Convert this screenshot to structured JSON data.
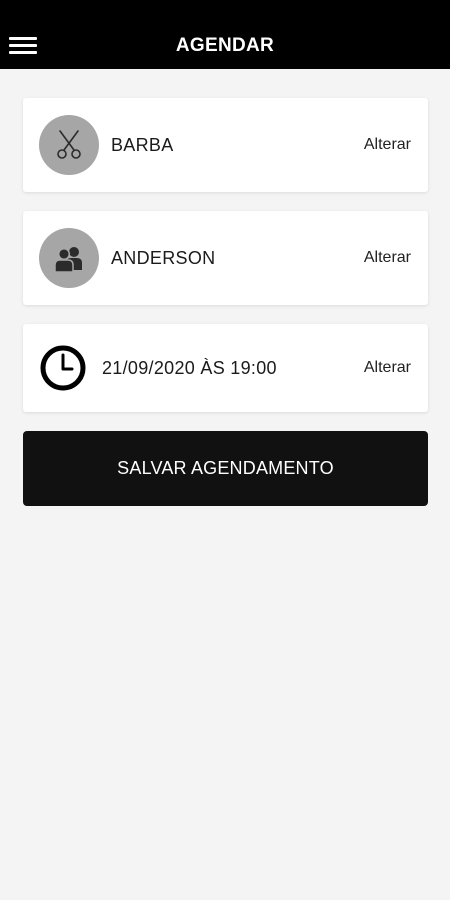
{
  "header": {
    "title": "AGENDAR",
    "menu_icon": "hamburger-menu-icon"
  },
  "cards": [
    {
      "label": "BARBA",
      "action": "Alterar",
      "icon": "scissors-icon"
    },
    {
      "label": "ANDERSON",
      "action": "Alterar",
      "icon": "people-icon"
    },
    {
      "label": "21/09/2020 ÀS 19:00",
      "action": "Alterar",
      "icon": "clock-icon"
    }
  ],
  "save_button": {
    "label": "SALVAR AGENDAMENTO"
  },
  "colors": {
    "header_bg": "#000000",
    "page_bg": "#f4f4f4",
    "avatar_bg": "#a6a6a6",
    "button_bg": "#111111"
  }
}
